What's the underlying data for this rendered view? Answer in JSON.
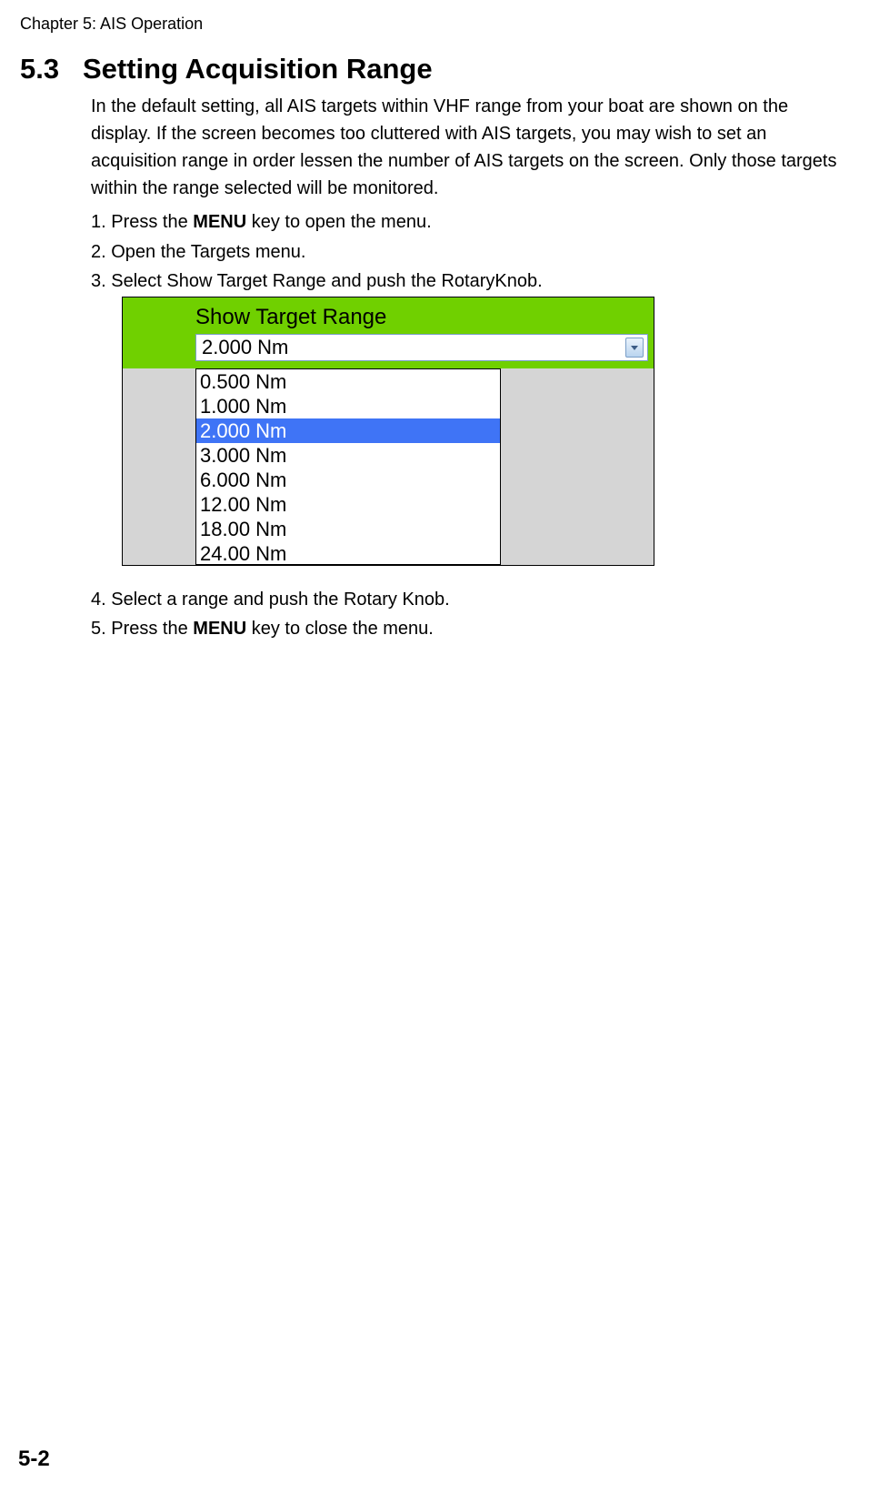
{
  "header": {
    "chapter": "Chapter 5: AIS Operation"
  },
  "section": {
    "number": "5.3",
    "title": "Setting Acquisition Range",
    "intro": "In the default setting, all AIS targets within VHF range from your boat are shown on the display. If the screen becomes too cluttered with AIS targets, you may wish to set an acquisition range in order lessen the number of AIS targets on the screen. Only those targets within the range selected will be monitored."
  },
  "steps": {
    "s1_a": "1. Press the ",
    "s1_bold": "MENU",
    "s1_b": " key to open the menu.",
    "s2": "2. Open the Targets menu.",
    "s3": "3. Select Show Target Range and push the RotaryKnob.",
    "s4": "4. Select a range and push the Rotary Knob.",
    "s5_a": "5. Press the ",
    "s5_bold": "MENU",
    "s5_b": " key to close the menu."
  },
  "figure": {
    "title": "Show Target Range",
    "selected_display": "2.000 Nm",
    "options": [
      "0.500 Nm",
      "1.000 Nm",
      "2.000 Nm",
      "3.000 Nm",
      "6.000 Nm",
      "12.00 Nm",
      "18.00 Nm",
      "24.00 Nm"
    ],
    "selected_index": 2
  },
  "footer": {
    "page": "5-2"
  }
}
